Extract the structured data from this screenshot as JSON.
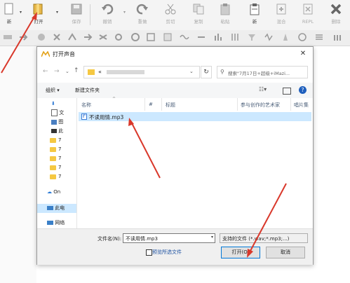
{
  "toolbar": {
    "new_label": "新",
    "open_label": "打开",
    "save_label": "保存",
    "undo_label": "撤销",
    "redo_label": "重做",
    "cut_label": "剪切",
    "copy_label": "复制",
    "paste_label": "粘贴",
    "new2_label": "新",
    "mix_label": "混合",
    "repl_label": "REPL",
    "delete_label": "删除"
  },
  "dialog": {
    "title": "打开声音",
    "path_prefix": "«",
    "search_placeholder": "搜索\"7月17日+超级+iMazi...",
    "organize_label": "组织 ▾",
    "new_folder_label": "新建文件夹",
    "columns": [
      "名称",
      "#",
      "标题",
      "参与创作的艺术家",
      "唱片集"
    ],
    "nav_items": [
      "↓",
      "文",
      "图",
      "此",
      "7",
      "7",
      "7",
      "7",
      "7",
      "On",
      "此电",
      "网络"
    ],
    "files": [
      {
        "name": "不读用情.mp3"
      }
    ],
    "filename_label": "文件名(N):",
    "filename_value": "不读用情.mp3",
    "filetype_value": "支持的文件 (*.wav;*.mp3;...)",
    "preview_label": "预览所选文件",
    "open_button": "打开(O)",
    "cancel_button": "取消"
  },
  "colors": {
    "arrow": "#d9382b",
    "selection": "#cce8ff",
    "accent": "#0078d7"
  }
}
